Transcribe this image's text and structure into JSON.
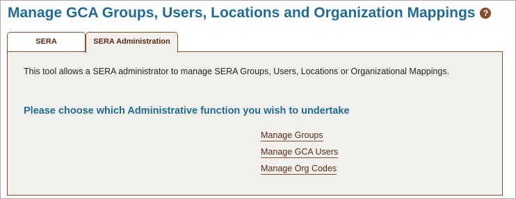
{
  "page": {
    "title": "Manage GCA Groups, Users, Locations and Organization Mappings",
    "help_icon": "question-mark-icon",
    "help_glyph": "?"
  },
  "tabs": [
    {
      "label": "SERA",
      "active": false
    },
    {
      "label": "SERA Administration",
      "active": true
    }
  ],
  "panel": {
    "intro": "This tool allows a SERA administrator to manage SERA Groups, Users, Locations or Organizational Mappings.",
    "heading": "Please choose which Administrative function you wish to undertake",
    "links": [
      {
        "label": "Manage Groups"
      },
      {
        "label": "Manage GCA Users"
      },
      {
        "label": "Manage Org Codes"
      }
    ]
  },
  "colors": {
    "title": "#1e6b96",
    "accent_brown": "#8a4b2c",
    "panel_bg": "#f2f0ed"
  }
}
